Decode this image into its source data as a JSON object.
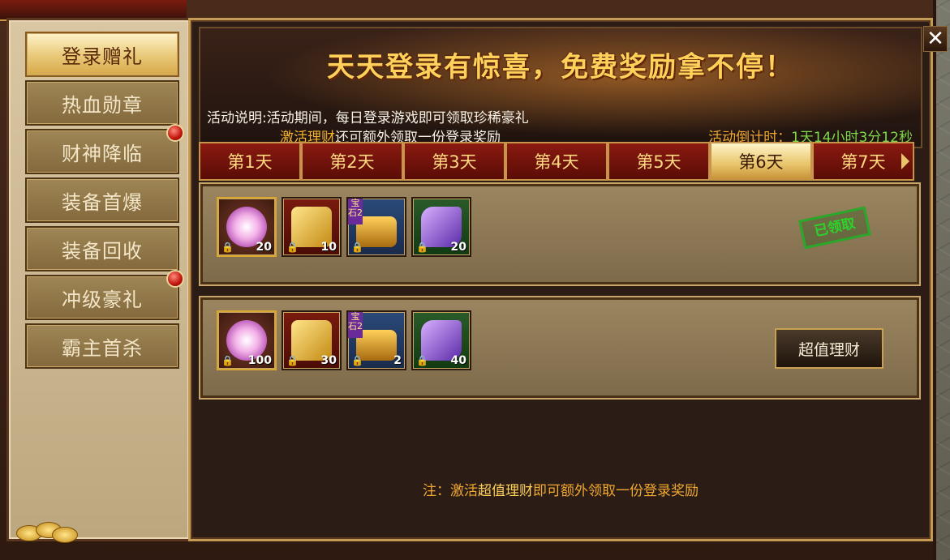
{
  "sidebar": {
    "items": [
      {
        "label": "登录赠礼",
        "active": true,
        "badge": false
      },
      {
        "label": "热血勋章",
        "active": false,
        "badge": false
      },
      {
        "label": "财神降临",
        "active": false,
        "badge": true
      },
      {
        "label": "装备首爆",
        "active": false,
        "badge": false
      },
      {
        "label": "装备回收",
        "active": false,
        "badge": false
      },
      {
        "label": "冲级豪礼",
        "active": false,
        "badge": true
      },
      {
        "label": "霸主首杀",
        "active": false,
        "badge": false
      }
    ]
  },
  "banner": {
    "title": "天天登录有惊喜，免费奖励拿不停！",
    "desc_line1": "活动说明:活动期间，每日登录游戏即可领取珍稀豪礼",
    "desc_line2_highlight": "激活理财",
    "desc_line2_rest": "还可额外领取一份登录奖励",
    "countdown_label": "活动倒计时：",
    "countdown_value": "1天14小时3分12秒"
  },
  "tabs": [
    {
      "label": "第1天",
      "active": false
    },
    {
      "label": "第2天",
      "active": false
    },
    {
      "label": "第3天",
      "active": false
    },
    {
      "label": "第4天",
      "active": false
    },
    {
      "label": "第5天",
      "active": false
    },
    {
      "label": "第6天",
      "active": true
    },
    {
      "label": "第7天",
      "active": false
    }
  ],
  "rows": [
    {
      "items": [
        {
          "icon": "pink-orb-icon",
          "count": "20"
        },
        {
          "icon": "gold-dragon-icon",
          "count": "10"
        },
        {
          "icon": "treasure-chest-icon",
          "tag": "宝石2",
          "count": ""
        },
        {
          "icon": "purple-crystal-icon",
          "count": "20"
        }
      ],
      "status": "已领取"
    },
    {
      "items": [
        {
          "icon": "pink-orb-icon",
          "count": "100"
        },
        {
          "icon": "gold-dragon-icon",
          "count": "30"
        },
        {
          "icon": "treasure-chest-icon",
          "tag": "宝石2",
          "count": "2"
        },
        {
          "icon": "purple-crystal-icon",
          "count": "40"
        }
      ],
      "button": "超值理财"
    }
  ],
  "note": {
    "prefix": "注：激活",
    "highlight": "超值理财",
    "suffix": "即可额外领取一份登录奖励"
  },
  "colors": {
    "accent_gold": "#ffd05a",
    "countdown_green": "#7dd84a",
    "claimed_green": "#2ad42a"
  }
}
